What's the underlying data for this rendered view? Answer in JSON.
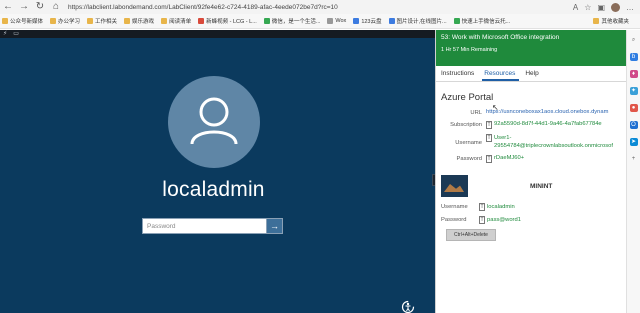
{
  "browser": {
    "url": "https://labclient.labondemand.com/LabClient/92fe4e62-c724-4189-afac-4eede072be7d?rc=10",
    "nav_icons": [
      "back-icon",
      "forward-icon",
      "refresh-icon",
      "home-icon"
    ],
    "bookmarks": [
      {
        "label": "公众号新媒体",
        "color": "#e8b54a"
      },
      {
        "label": "办公学习",
        "color": "#e8b54a"
      },
      {
        "label": "工作相关",
        "color": "#e8b54a"
      },
      {
        "label": "娱乐游戏",
        "color": "#e8b54a"
      },
      {
        "label": "阅读清单",
        "color": "#e8b54a"
      },
      {
        "label": "新蜂视频 - LCG - L...",
        "color": "#d94a3b"
      },
      {
        "label": "微信，是一个生活...",
        "color": "#35a852"
      },
      {
        "label": "Wox",
        "color": "#999999"
      },
      {
        "label": "123云盘",
        "color": "#3c7be0"
      },
      {
        "label": "图片设计,在线图片...",
        "color": "#3c7be0"
      },
      {
        "label": "快速上手微信云托...",
        "color": "#35a852"
      }
    ],
    "bookmarks_more": "其他收藏夹"
  },
  "vm": {
    "username": "localadmin",
    "password_placeholder": "Password",
    "submit_glyph": "→"
  },
  "panel": {
    "lab_title": "53: Work with Microsoft Office integration",
    "time_remaining": "1 Hr 57 Min Remaining",
    "tabs": [
      "Instructions",
      "Resources",
      "Help"
    ],
    "active_tab": "Resources",
    "section_title": "Azure Portal",
    "url_label": "URL",
    "url_value": "https://usnconeboxax1aos.cloud.onebox.dynam",
    "subscription_label": "Subscription",
    "subscription_value": "92a5590d-8d7f-44d1-9a46-4a7fab67784e",
    "username_label": "Username",
    "username_value_line1": "User1-",
    "username_value_line2": "29554784@triplecrownlabsoutlook.onmicrosof",
    "password_label": "Password",
    "password_value": "rDaeMJ60+",
    "vm_name": "MININT",
    "vm_username_label": "Username",
    "vm_username_value": "localadmin",
    "vm_password_label": "Password",
    "vm_password_value": "pass@word1",
    "cad_button": "Ctrl+Alt+Delete",
    "copy_glyph": "T"
  },
  "colors": {
    "vm_background": "#0b3a5e",
    "lab_header": "#1f8a3c",
    "credential_text": "#1f8a3c",
    "active_tab": "#1f5fa6"
  }
}
